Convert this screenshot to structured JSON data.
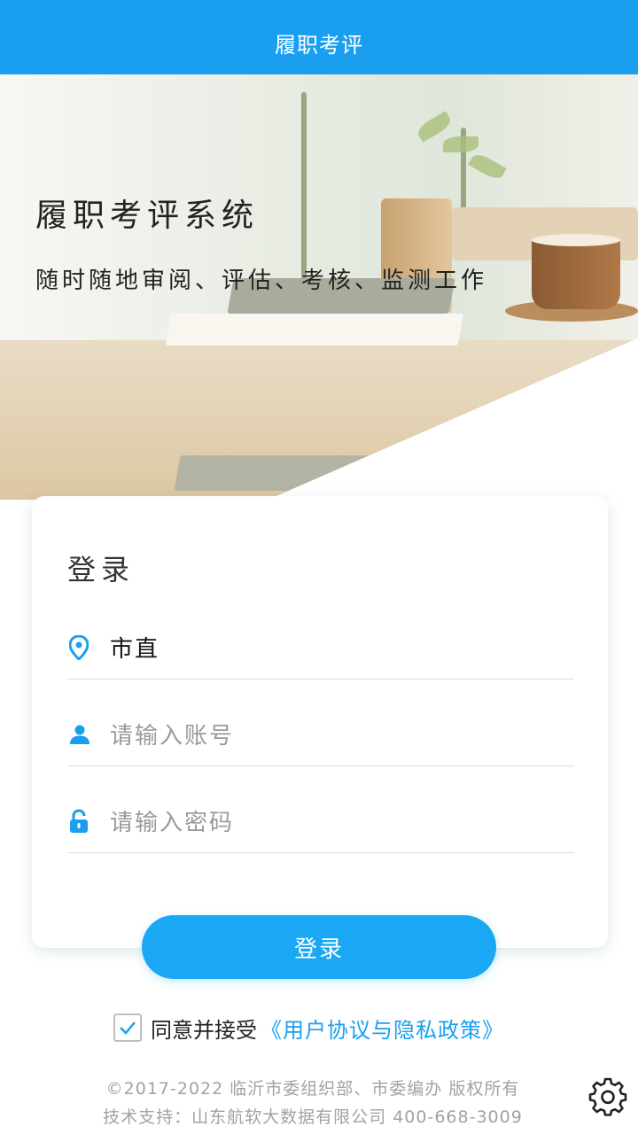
{
  "header": {
    "title": "履职考评"
  },
  "hero": {
    "title": "履职考评系统",
    "subtitle": "随时随地审阅、评估、考核、监测工作"
  },
  "login_card": {
    "title": "登录",
    "region": {
      "icon": "location-pin-icon",
      "value": "市直"
    },
    "account": {
      "icon": "user-icon",
      "placeholder": "请输入账号"
    },
    "password": {
      "icon": "lock-icon",
      "placeholder": "请输入密码"
    }
  },
  "login_button": {
    "label": "登录"
  },
  "agreement": {
    "checked": true,
    "text": "同意并接受",
    "link": "《用户协议与隐私政策》"
  },
  "footer": {
    "copyright": "©2017-2022 临沂市委组织部、市委编办 版权所有",
    "support": "技术支持：山东航软大数据有限公司 400-668-3009"
  },
  "colors": {
    "accent": "#1a9ff0",
    "button": "#1aa8f5"
  }
}
